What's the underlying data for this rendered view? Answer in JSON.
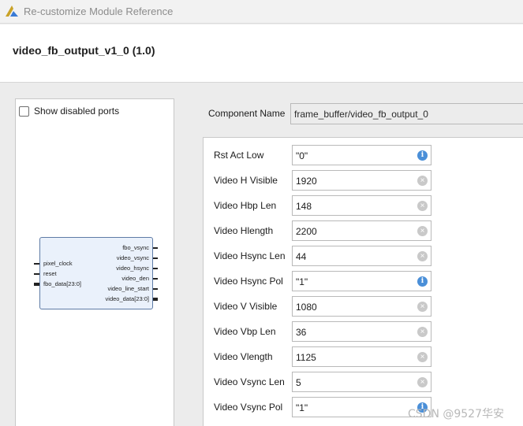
{
  "window": {
    "title": "Re-customize Module Reference",
    "logo_icon": "vivado-logo-icon"
  },
  "header": {
    "title": "video_fb_output_v1_0 (1.0)"
  },
  "preview": {
    "show_disabled_ports_label": "Show disabled ports",
    "show_disabled_ports_checked": false,
    "block": {
      "inputs": [
        "pixel_clock",
        "reset",
        "fbo_data[23:0]"
      ],
      "outputs": [
        "fbo_vsync",
        "video_vsync",
        "video_hsync",
        "video_den",
        "video_line_start",
        "video_data[23:0]"
      ]
    }
  },
  "component": {
    "label": "Component Name",
    "value": "frame_buffer/video_fb_output_0"
  },
  "params": [
    {
      "label": "Rst Act Low",
      "value": "\"0\"",
      "icon": "info-icon"
    },
    {
      "label": "Video H Visible",
      "value": "1920",
      "icon": "clear-icon"
    },
    {
      "label": "Video Hbp Len",
      "value": "148",
      "icon": "clear-icon"
    },
    {
      "label": "Video Hlength",
      "value": "2200",
      "icon": "clear-icon"
    },
    {
      "label": "Video Hsync Len",
      "value": "44",
      "icon": "clear-icon"
    },
    {
      "label": "Video Hsync Pol",
      "value": "\"1\"",
      "icon": "info-icon"
    },
    {
      "label": "Video V Visible",
      "value": "1080",
      "icon": "clear-icon"
    },
    {
      "label": "Video Vbp Len",
      "value": "36",
      "icon": "clear-icon"
    },
    {
      "label": "Video Vlength",
      "value": "1125",
      "icon": "clear-icon"
    },
    {
      "label": "Video Vsync Len",
      "value": "5",
      "icon": "clear-icon"
    },
    {
      "label": "Video Vsync Pol",
      "value": "\"1\"",
      "icon": "info-icon"
    }
  ],
  "watermark": "CSDN @9527华安",
  "colors": {
    "info": "#4a8fd8",
    "clear": "#c9c9c9",
    "block_fill": "#eaf1fb",
    "block_border": "#5e7ba6"
  }
}
